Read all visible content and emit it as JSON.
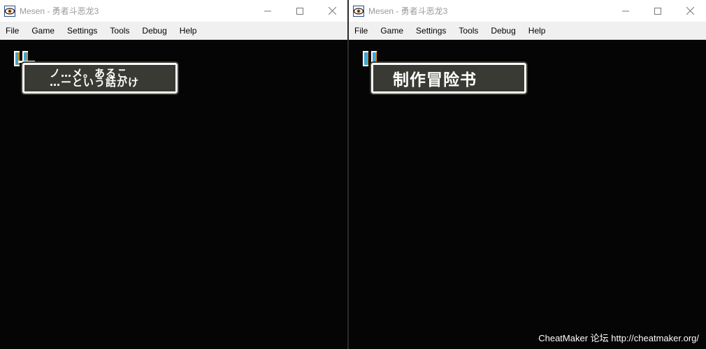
{
  "windows": [
    {
      "title": "Mesen - 勇者斗恶龙3",
      "menu": [
        "File",
        "Game",
        "Settings",
        "Tools",
        "Debug",
        "Help"
      ],
      "dialog_text": "ノ…メ。あるこ\n…ーという話がけ"
    },
    {
      "title": "Mesen - 勇者斗恶龙3",
      "menu": [
        "File",
        "Game",
        "Settings",
        "Tools",
        "Debug",
        "Help"
      ],
      "dialog_text": "制作冒险书"
    }
  ],
  "watermark": "CheatMaker 论坛 http://cheatmaker.org/",
  "colors": {
    "titlebar_bg": "#ffffff",
    "menubar_bg": "#f0f0f0",
    "game_bg": "#050505",
    "dialog_bg": "#3a3a35",
    "dialog_border": "#ffffff",
    "cursor_blue": "#3ca6d8",
    "cursor_orange": "#e08a00"
  },
  "icons": {
    "app": "mesen-eye-icon",
    "minimize": "minimize-icon",
    "maximize": "maximize-icon",
    "close": "close-icon"
  }
}
